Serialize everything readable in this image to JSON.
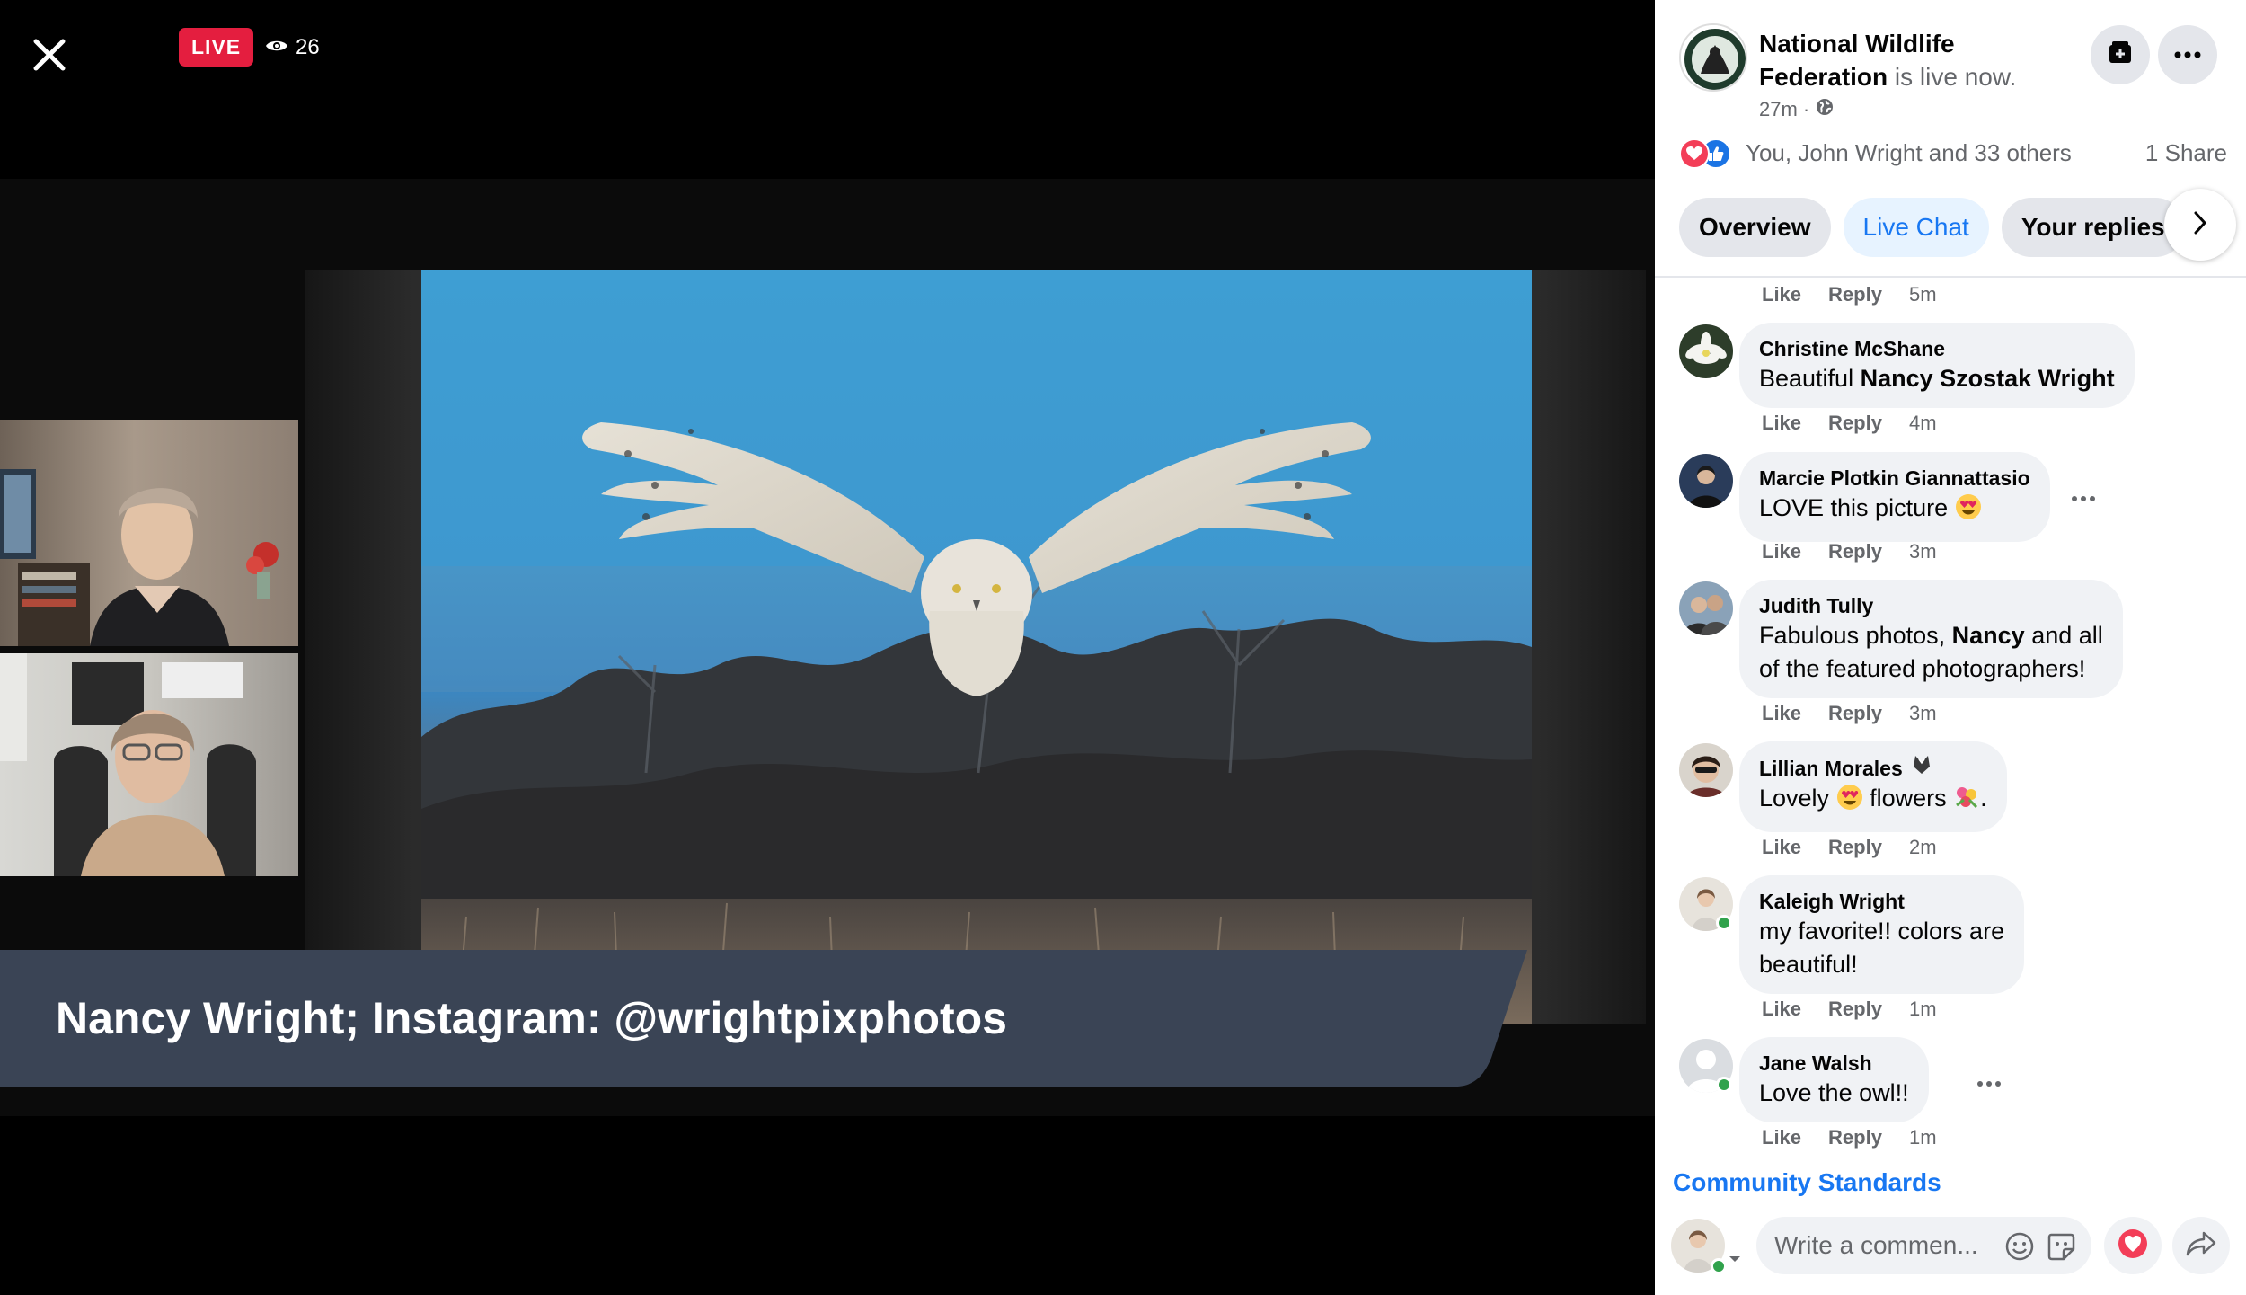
{
  "video": {
    "live_label": "LIVE",
    "viewer_count": "26",
    "caption": "Nancy Wright; Instagram: @wrightpixphotos"
  },
  "post": {
    "page_name": "National Wildlife Federation",
    "status_suffix": " is live now.",
    "time": "27m ·",
    "reactions_text": "You, John Wright and 33 others",
    "shares_text": "1 Share"
  },
  "tabs": [
    {
      "label": "Overview"
    },
    {
      "label": "Live Chat"
    },
    {
      "label": "Your replies"
    }
  ],
  "actions": {
    "like": "Like",
    "reply": "Reply"
  },
  "first_action_time": "5m",
  "comments": [
    {
      "name": "Christine McShane",
      "text_pre": "Beautiful ",
      "mention": "Nancy Szostak Wright",
      "text_post": "",
      "time": "4m"
    },
    {
      "name": "Marcie Plotkin Giannattasio",
      "text_pre": "LOVE this picture ",
      "mention": "",
      "text_post": "",
      "time": "3m"
    },
    {
      "name": "Judith Tully",
      "text_line1_pre": "Fabulous photos, ",
      "mention": "Nancy",
      "text_line1_post": " and all",
      "text_line2": "of the featured photographers!",
      "time": "3m"
    },
    {
      "name": "Lillian Morales",
      "text_pre": "Lovely ",
      "text_mid": " flowers ",
      "text_post": ".",
      "time": "2m"
    },
    {
      "name": "Kaleigh Wright",
      "text_line1": "my favorite!! colors are",
      "text_line2": "beautiful!",
      "time": "1m"
    },
    {
      "name": "Jane Walsh",
      "text_pre": "Love the owl!!",
      "time": "1m"
    }
  ],
  "community_standards": "Community Standards",
  "composer": {
    "placeholder": "Write a commen..."
  },
  "colors": {
    "accent": "#1877f2",
    "live": "#e41e3f",
    "love": "#f33e58",
    "online": "#31a24c"
  }
}
